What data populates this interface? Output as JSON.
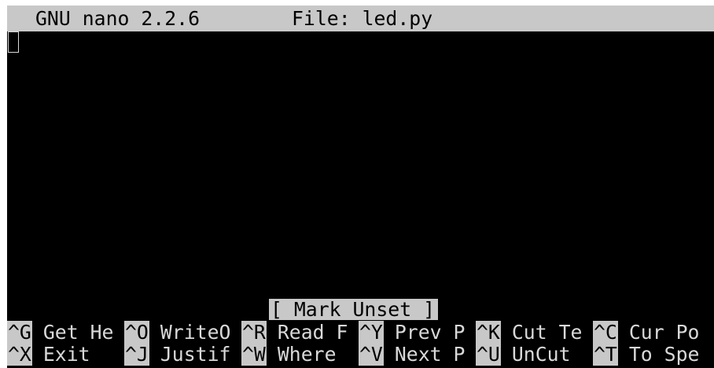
{
  "title_bar": {
    "app_name": "GNU nano 2.2.6",
    "file_label": "File: led.py"
  },
  "editor": {
    "content": ""
  },
  "status": {
    "message": "[ Mark Unset ]"
  },
  "shortcuts": {
    "row1": [
      {
        "key": "^G",
        "label": "Get He"
      },
      {
        "key": "^O",
        "label": "WriteO"
      },
      {
        "key": "^R",
        "label": "Read F"
      },
      {
        "key": "^Y",
        "label": "Prev P"
      },
      {
        "key": "^K",
        "label": "Cut Te"
      },
      {
        "key": "^C",
        "label": "Cur Po"
      }
    ],
    "row2": [
      {
        "key": "^X",
        "label": "Exit"
      },
      {
        "key": "^J",
        "label": "Justif"
      },
      {
        "key": "^W",
        "label": "Where"
      },
      {
        "key": "^V",
        "label": "Next P"
      },
      {
        "key": "^U",
        "label": "UnCut"
      },
      {
        "key": "^T",
        "label": "To Spe"
      }
    ]
  },
  "colors": {
    "background": "#000000",
    "foreground": "#d9d9d9",
    "highlight": "#c8c8c8"
  }
}
